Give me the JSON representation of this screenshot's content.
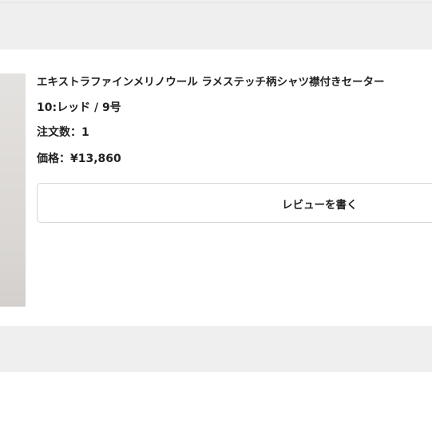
{
  "order_item": {
    "product_name": "エキストラファインメリノウール ラメステッチ柄シャツ襟付きセーター",
    "variant": "10:レッド / 9号",
    "quantity_text": "注文数：1",
    "price_text": "価格：¥13,860",
    "review_button_label": "レビューを書く"
  }
}
